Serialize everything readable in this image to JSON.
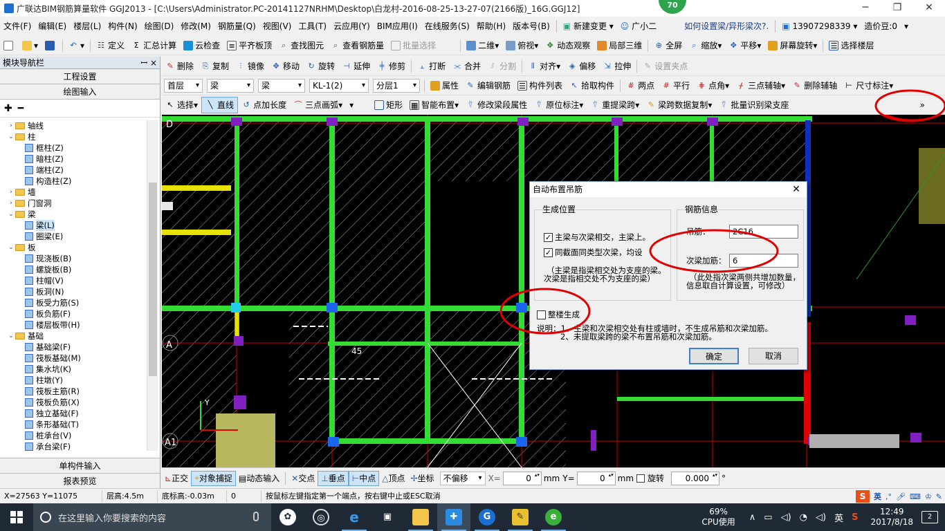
{
  "window": {
    "title": "广联达BIM钢筋算量软件 GGJ2013 - [C:\\Users\\Administrator.PC-20141127NRHM\\Desktop\\白龙村-2016-08-25-13-27-07(2166版)_16G.GGJ12]",
    "badge": "70"
  },
  "menu": {
    "items": [
      "文件(F)",
      "编辑(E)",
      "楼层(L)",
      "构件(N)",
      "绘图(D)",
      "修改(M)",
      "钢筋量(Q)",
      "视图(V)",
      "工具(T)",
      "云应用(Y)",
      "BIM应用(I)",
      "在线服务(S)",
      "帮助(H)",
      "版本号(B)"
    ],
    "new_change": "新建变更",
    "guang": "广小二",
    "question": "如何设置梁/异形梁次?.",
    "phone": "13907298339",
    "coins": "造价豆:0"
  },
  "toolbar1": {
    "define": "定义",
    "sum": "汇总计算",
    "cloud_check": "云检查",
    "flat_board": "平齐板顶",
    "find": "查找图元",
    "view_rebar": "查看钢筋量",
    "batch_select": "批量选择",
    "view_mode": "二维",
    "top_view": "俯视",
    "dynamic": "动态观察",
    "local3d": "局部三维",
    "full_screen": "全屏",
    "zoom": "缩放",
    "pan": "平移",
    "screen_rotate": "屏幕旋转",
    "select_floor": "选择楼层"
  },
  "toolbar2": {
    "delete": "删除",
    "copy": "复制",
    "mirror": "镜像",
    "move": "移动",
    "rotate": "旋转",
    "extend": "延伸",
    "trim": "修剪",
    "break": "打断",
    "merge": "合并",
    "split": "分割",
    "align": "对齐",
    "offset": "偏移",
    "stretch": "拉伸",
    "set_node": "设置夹点"
  },
  "toolbar3": {
    "floor": "首层",
    "type1": "梁",
    "type2": "梁",
    "member": "KL-1(2)",
    "layer": "分层1",
    "props": "属性",
    "edit_rebar": "编辑钢筋",
    "member_list": "构件列表",
    "pick": "拾取构件",
    "two_point": "两点",
    "parallel": "平行",
    "point_angle": "点角",
    "three_aux": "三点辅轴",
    "del_aux": "删除辅轴",
    "dim": "尺寸标注"
  },
  "toolbar4": {
    "select": "选择",
    "line": "直线",
    "point_len": "点加长度",
    "arc3": "三点画弧",
    "rect": "矩形",
    "smart": "智能布置",
    "modify_span": "修改梁段属性",
    "orig_mark": "原位标注",
    "reextract": "重提梁跨",
    "span_copy": "梁跨数据复制",
    "batch_identify": "批量识别梁支座",
    "more": "»"
  },
  "left_panel": {
    "title": "模块导航栏",
    "pin": "ꟷ ×",
    "project_settings": "工程设置",
    "draw_input": "绘图输入",
    "single_input": "单构件输入",
    "report": "报表预览"
  },
  "tree": [
    {
      "lvl": 0,
      "tog": "›",
      "folder": true,
      "label": "轴线"
    },
    {
      "lvl": 0,
      "tog": "⌄",
      "folder": true,
      "label": "柱"
    },
    {
      "lvl": 1,
      "label": "框柱(Z)"
    },
    {
      "lvl": 1,
      "label": "暗柱(Z)"
    },
    {
      "lvl": 1,
      "label": "端柱(Z)"
    },
    {
      "lvl": 1,
      "label": "构造柱(Z)"
    },
    {
      "lvl": 0,
      "tog": "›",
      "folder": true,
      "label": "墙"
    },
    {
      "lvl": 0,
      "tog": "›",
      "folder": true,
      "label": "门窗洞"
    },
    {
      "lvl": 0,
      "tog": "⌄",
      "folder": true,
      "label": "梁"
    },
    {
      "lvl": 1,
      "label": "梁(L)",
      "sel": true
    },
    {
      "lvl": 1,
      "label": "圈梁(E)"
    },
    {
      "lvl": 0,
      "tog": "⌄",
      "folder": true,
      "label": "板"
    },
    {
      "lvl": 1,
      "label": "现浇板(B)"
    },
    {
      "lvl": 1,
      "label": "螺旋板(B)"
    },
    {
      "lvl": 1,
      "label": "柱帽(V)"
    },
    {
      "lvl": 1,
      "label": "板洞(N)"
    },
    {
      "lvl": 1,
      "label": "板受力筋(S)"
    },
    {
      "lvl": 1,
      "label": "板负筋(F)"
    },
    {
      "lvl": 1,
      "label": "楼层板带(H)"
    },
    {
      "lvl": 0,
      "tog": "⌄",
      "folder": true,
      "label": "基础"
    },
    {
      "lvl": 1,
      "label": "基础梁(F)"
    },
    {
      "lvl": 1,
      "label": "筏板基础(M)"
    },
    {
      "lvl": 1,
      "label": "集水坑(K)"
    },
    {
      "lvl": 1,
      "label": "柱墩(Y)"
    },
    {
      "lvl": 1,
      "label": "筏板主筋(R)"
    },
    {
      "lvl": 1,
      "label": "筏板负筋(X)"
    },
    {
      "lvl": 1,
      "label": "独立基础(F)"
    },
    {
      "lvl": 1,
      "label": "条形基础(T)"
    },
    {
      "lvl": 1,
      "label": "桩承台(V)"
    },
    {
      "lvl": 1,
      "label": "承台梁(F)"
    }
  ],
  "canvas": {
    "axis_d": "D",
    "axis_a": "A",
    "axis_a1": "A1",
    "dim_45": "45",
    "axis_y": "Y"
  },
  "dialog": {
    "title": "自动布置吊筋",
    "close": "✕",
    "gen_pos": "生成位置",
    "cb1": "主梁与次梁相交，主梁上。",
    "cb2": "同截面同类型次梁，均设",
    "note1": "（主梁是指梁相交处为支座的梁。",
    "note2": "次梁是指相交处不为支座的梁）",
    "rebar_info": "钢筋信息",
    "hanger_label": "吊筋：",
    "hanger_value": "2C16",
    "sec_label": "次梁加筋：",
    "sec_value": "6",
    "note3": "（此处指次梁两侧共增加数量，",
    "note4": "信息取自计算设置，可修改）",
    "whole_building": "整楼生成",
    "desc1": "说明：1、主梁和次梁相交处有柱或墙时，不生成吊筋和次梁加筋。",
    "desc2": "2、未提取梁跨的梁不布置吊筋和次梁加筋。",
    "ok": "确定",
    "cancel": "取消"
  },
  "bottom": {
    "ortho": "正交",
    "snap": "对象捕捉",
    "dyn_input": "动态输入",
    "intersect": "交点",
    "perp": "垂点",
    "mid": "中点",
    "vertex": "顶点",
    "coord": "坐标",
    "no_offset": "不偏移",
    "x_label": "X=",
    "x_val": "0",
    "mm1": "mm",
    "y_label": "Y=",
    "y_val": "0",
    "mm2": "mm",
    "rot": "旋转",
    "rot_val": "0.000",
    "deg": "°"
  },
  "status": {
    "coords": "X=27563 Y=11075",
    "floor_h": "层高:4.5m",
    "bottom_h": "底标高:-0.03m",
    "zero": "0",
    "hint": "按鼠标左键指定第一个端点，按右键中止或ESC取消",
    "ime": "英"
  },
  "taskbar": {
    "search": "在这里输入你要搜索的内容",
    "cpu_pct": "69%",
    "cpu_label": "CPU使用",
    "lang": "英",
    "time": "12:49",
    "date": "2017/8/18",
    "notif": "2"
  },
  "colors": {
    "beam_green": "#33dd33",
    "annot_red": "#e00000",
    "canvas_bg": "#000000"
  }
}
